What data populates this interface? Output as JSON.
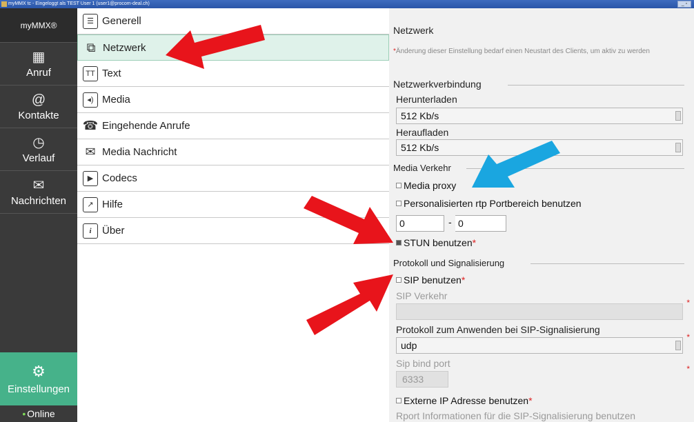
{
  "window": {
    "title": "myMMX tc - Eingeloggt als TEST User 1 (user1@procom-deal.ch)"
  },
  "rail": {
    "logo": "myMMX®",
    "items": [
      {
        "label": "Anruf",
        "icon": "dialpad-icon",
        "glyph": "▦"
      },
      {
        "label": "Kontakte",
        "icon": "contacts-icon",
        "glyph": "@"
      },
      {
        "label": "Verlauf",
        "icon": "clock-icon",
        "glyph": "◷"
      },
      {
        "label": "Nachrichten",
        "icon": "message-icon",
        "glyph": "✉"
      }
    ],
    "settings": {
      "label": "Einstellungen",
      "icon": "gear-icon",
      "glyph": "⚙"
    },
    "status": "Online"
  },
  "menu": {
    "items": [
      {
        "label": "Generell",
        "icon": "list-icon",
        "glyph": "☰"
      },
      {
        "label": "Netzwerk",
        "icon": "network-icon",
        "glyph": "⧉"
      },
      {
        "label": "Text",
        "icon": "text-icon",
        "glyph": "TT"
      },
      {
        "label": "Media",
        "icon": "speaker-icon",
        "glyph": "◂)"
      },
      {
        "label": "Eingehende Anrufe",
        "icon": "incoming-call-icon",
        "glyph": "☎"
      },
      {
        "label": "Media Nachricht",
        "icon": "media-message-icon",
        "glyph": "✉"
      },
      {
        "label": "Codecs",
        "icon": "clapper-icon",
        "glyph": "▶"
      },
      {
        "label": "Hilfe",
        "icon": "help-icon",
        "glyph": "↗"
      },
      {
        "label": "Über",
        "icon": "info-icon",
        "glyph": "i"
      }
    ],
    "active": "Netzwerk"
  },
  "panel": {
    "title": "Netzwerk",
    "note": "Änderung dieser Einstellung bedarf einen Neustart des Clients, um aktiv zu werden",
    "net_section": "Netzwerkverbindung",
    "download_label": "Herunterladen",
    "download_value": "512 Kb/s",
    "upload_label": "Heraufladen",
    "upload_value": "512 Kb/s",
    "media_section": "Media Verkehr",
    "media_proxy": "Media proxy",
    "rtp_range": "Personalisierten rtp Portbereich benutzen",
    "rtp_from": "0",
    "rtp_sep": "- ",
    "rtp_to": "0",
    "stun": "STUN benutzen",
    "protocol_section": "Protokoll und Signalisierung",
    "sip_use": "SIP benutzen",
    "sip_traffic_label": "SIP Verkehr",
    "sip_protocol_label": "Protokoll zum Anwenden bei SIP-Signalisierung",
    "sip_protocol_value": "udp",
    "sip_bind_label": "Sip bind port",
    "sip_bind_value": "6333",
    "external_ip": "Externe IP Adresse benutzen",
    "rport": "Rport Informationen für die SIP-Signalisierung benutzen"
  },
  "colors": {
    "rail_bg": "#3a3a3a",
    "settings_accent": "#46b28a",
    "active_menu_bg": "#dff2ea",
    "annotation_red": "#e8141b",
    "annotation_blue": "#1aa6e0",
    "required_star": "#dd2222"
  }
}
